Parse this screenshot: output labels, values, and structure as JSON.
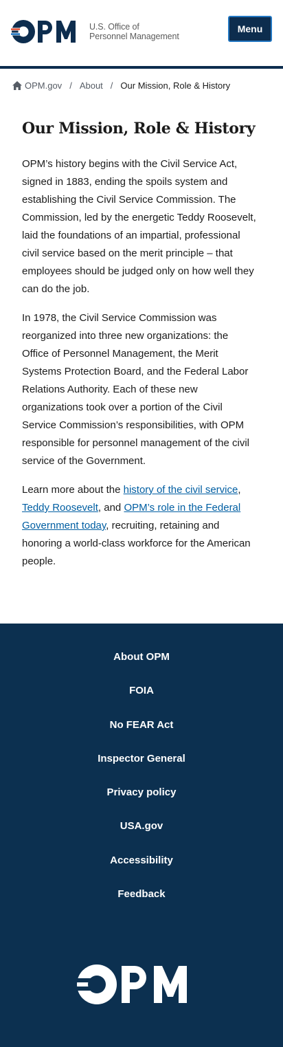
{
  "header": {
    "logo_text_line1": "U.S. Office of",
    "logo_text_line2": "Personnel Management",
    "menu_label": "Menu"
  },
  "breadcrumb": {
    "home_label": "OPM.gov",
    "separator": "/",
    "item2": "About",
    "current": "Our Mission, Role & History"
  },
  "main": {
    "title": "Our Mission, Role & History",
    "p1": "OPM’s history begins with the Civil Service Act, signed in 1883, ending the spoils system and establishing the Civil Service Commission.  The Commission, led by the energetic Teddy Roosevelt, laid the foundations of an impartial, professional civil service based on the merit principle – that employees should be judged only on how well they can do the job.",
    "p2": "In 1978, the Civil Service Commission was reorganized into three new organizations: the Office of Personnel Management, the Merit Systems Protection Board, and the Federal Labor Relations Authority.  Each of these new organizations took over a portion of the Civil Service Commission’s responsibilities, with OPM responsible for personnel management of the civil service of the Government.",
    "p3_prefix": "Learn more about the ",
    "p3_link1": "history of the civil service",
    "p3_mid1": ", ",
    "p3_link2": "Teddy Roosevelt",
    "p3_mid2": ", and ",
    "p3_link3": "OPM’s role in the Federal Government today",
    "p3_suffix": ", recruiting, retaining and honoring a world-class workforce for the American people."
  },
  "footer": {
    "links": [
      "About OPM",
      "FOIA",
      "No FEAR Act",
      "Inspector General",
      "Privacy policy",
      "USA.gov",
      "Accessibility",
      "Feedback"
    ]
  },
  "colors": {
    "navy": "#0d2d4e",
    "footer_bg": "#0c3050",
    "link": "#005ea2",
    "accent_red": "#e4583e",
    "accent_blue": "#2378c3"
  }
}
